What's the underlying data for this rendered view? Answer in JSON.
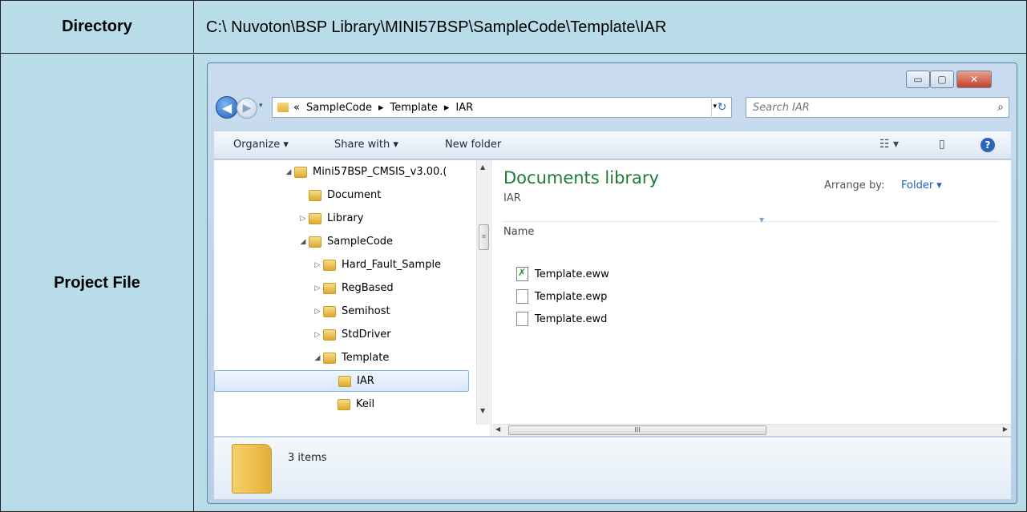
{
  "table": {
    "directory_label": "Directory",
    "directory_path": "C:\\ Nuvoton\\BSP Library\\MINI57BSP\\SampleCode\\Template\\IAR",
    "project_label": "Project File"
  },
  "explorer": {
    "window_buttons": {
      "minimize": "▭",
      "maximize": "▢",
      "close": "✕"
    },
    "nav": {
      "back": "◀",
      "forward": "▶",
      "history_dropdown": "▾",
      "prefix": "«",
      "crumbs": [
        "SampleCode",
        "Template",
        "IAR"
      ],
      "separator": "▸",
      "address_dropdown": "▾",
      "refresh": "↻"
    },
    "search": {
      "placeholder": "Search IAR",
      "icon": "search-icon"
    },
    "command_bar": {
      "organize": "Organize ▾",
      "share_with": "Share with ▾",
      "new_folder": "New folder",
      "view_icon": "☷ ▾",
      "preview_icon": "▯",
      "help_icon": "?"
    },
    "tree": [
      {
        "label": "Mini57BSP_CMSIS_v3.00.(",
        "indent": 0,
        "expander": "◢",
        "selected": false
      },
      {
        "label": "Document",
        "indent": 1,
        "expander": "",
        "selected": false
      },
      {
        "label": "Library",
        "indent": 1,
        "expander": "▷",
        "selected": false
      },
      {
        "label": "SampleCode",
        "indent": 1,
        "expander": "◢",
        "selected": false
      },
      {
        "label": "Hard_Fault_Sample",
        "indent": 2,
        "expander": "▷",
        "selected": false
      },
      {
        "label": "RegBased",
        "indent": 2,
        "expander": "▷",
        "selected": false
      },
      {
        "label": "Semihost",
        "indent": 2,
        "expander": "▷",
        "selected": false
      },
      {
        "label": "StdDriver",
        "indent": 2,
        "expander": "▷",
        "selected": false
      },
      {
        "label": "Template",
        "indent": 2,
        "expander": "◢",
        "selected": false
      },
      {
        "label": "IAR",
        "indent": 3,
        "expander": "",
        "selected": true
      },
      {
        "label": "Keil",
        "indent": 3,
        "expander": "",
        "selected": false
      }
    ],
    "tree_scroll": {
      "up": "▲",
      "thumb": "≡",
      "down": "▼"
    },
    "pane": {
      "library_title": "Documents library",
      "library_subtitle": "IAR",
      "arrange_label": "Arrange by:",
      "arrange_value": "Folder ▾",
      "column_name": "Name",
      "files": [
        {
          "name": "Template.eww",
          "type": "eww"
        },
        {
          "name": "Template.ewp",
          "type": "ewp"
        },
        {
          "name": "Template.ewd",
          "type": "ewd"
        }
      ],
      "hscroll": {
        "left": "◀",
        "thumb": "III",
        "right": "▶"
      }
    },
    "details": {
      "item_count": "3 items"
    }
  }
}
